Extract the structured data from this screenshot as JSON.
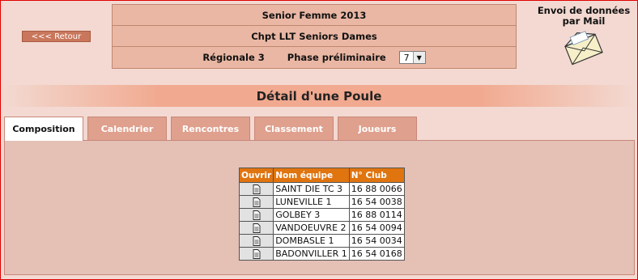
{
  "back_button": "<<< Retour",
  "info": {
    "season": "Senior Femme  2013",
    "championship": "Chpt LLT Seniors Dames",
    "division": "Régionale 3",
    "phase_label": "Phase préliminaire",
    "phase_select_value": "7"
  },
  "mail": {
    "label_line1": "Envoi de données",
    "label_line2": "par Mail"
  },
  "banner_title": "Détail d'une Poule",
  "tabs": [
    {
      "label": "Composition"
    },
    {
      "label": "Calendrier"
    },
    {
      "label": "Rencontres"
    },
    {
      "label": "Classement"
    },
    {
      "label": "Joueurs"
    }
  ],
  "table": {
    "headers": [
      "Ouvrir",
      "Nom équipe",
      "N° Club"
    ],
    "rows": [
      {
        "team": "SAINT DIE TC 3",
        "club": "16 88 0066"
      },
      {
        "team": "LUNEVILLE 1",
        "club": "16 54 0038"
      },
      {
        "team": "GOLBEY 3",
        "club": "16 88 0114"
      },
      {
        "team": "VANDOEUVRE 2",
        "club": "16 54 0094"
      },
      {
        "team": "DOMBASLE 1",
        "club": "16 54 0034"
      },
      {
        "team": "BADONVILLER 1",
        "club": "16 54 0168"
      }
    ]
  },
  "colors": {
    "frame_border": "#e00000",
    "background": "#f3d9d1",
    "header_orange": "#e0740f",
    "tab_inactive": "#dfa08d"
  }
}
